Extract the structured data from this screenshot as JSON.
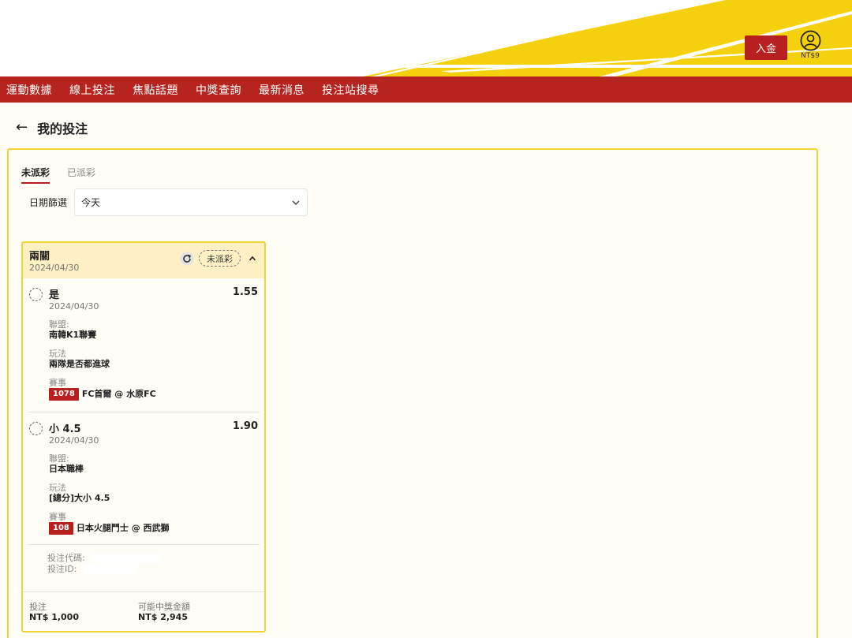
{
  "header": {
    "deposit_label": "入金",
    "balance": "NT$9",
    "brand_colors": {
      "yellow": "#f5d10d",
      "red": "#b8201f"
    }
  },
  "nav": {
    "items": [
      "運動數據",
      "線上投注",
      "焦點話題",
      "中獎查詢",
      "最新消息",
      "投注站搜尋"
    ]
  },
  "page": {
    "title": "我的投注"
  },
  "tabs": [
    {
      "label": "未派彩",
      "active": true
    },
    {
      "label": "已派彩",
      "active": false
    }
  ],
  "filter": {
    "label": "日期篩選",
    "selected": "今天"
  },
  "bet": {
    "type": "兩關",
    "date": "2024/04/30",
    "status": "未派彩",
    "selections": [
      {
        "name": "是",
        "date": "2024/04/30",
        "odds": "1.55",
        "league_label": "聯盟:",
        "league": "南韓K1聯賽",
        "play_label": "玩法",
        "play": "兩隊是否都進球",
        "match_label": "賽事",
        "match_no": "1078",
        "match": "FC首爾 @ 水原FC"
      },
      {
        "name": "小 4.5",
        "date": "2024/04/30",
        "odds": "1.90",
        "league_label": "聯盟:",
        "league": "日本職棒",
        "play_label": "玩法",
        "play": "[總分]大小 4.5",
        "match_label": "賽事",
        "match_no": "108",
        "match": "日本火腿鬥士 @ 西武獅"
      }
    ],
    "code_label": "投注代碼:",
    "id_label": "投注ID:",
    "stake_label": "投注",
    "stake": "NT$ 1,000",
    "payout_label": "可能中獎金額",
    "payout": "NT$ 2,945"
  }
}
